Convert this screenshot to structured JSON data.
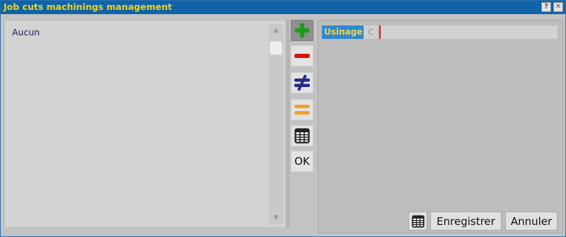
{
  "window": {
    "title": "Job cuts machinings management",
    "help_label": "?",
    "close_label": "✕",
    "colors": {
      "titlebar": "#0f64a8",
      "title_text": "#f2d21a"
    }
  },
  "list": {
    "items": [
      "Aucun"
    ]
  },
  "toolbar": {
    "buttons": [
      {
        "icon": "plus-icon",
        "active": true
      },
      {
        "icon": "minus-icon"
      },
      {
        "icon": "not-equal-icon"
      },
      {
        "icon": "equal-icon"
      },
      {
        "icon": "grid-icon"
      },
      {
        "label": "OK"
      }
    ]
  },
  "form": {
    "usinage_label": "Usinage:",
    "usinage_prefix": "C",
    "usinage_value": ""
  },
  "footer": {
    "save_label": "Enregistrer",
    "cancel_label": "Annuler"
  }
}
